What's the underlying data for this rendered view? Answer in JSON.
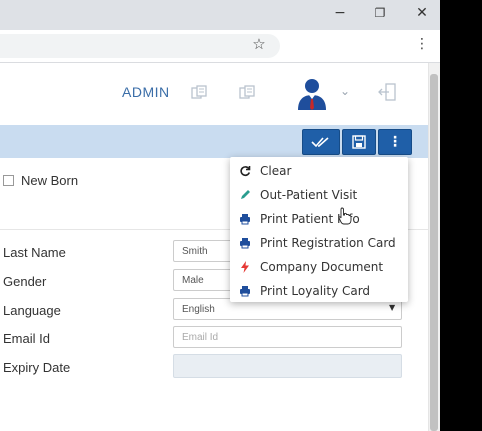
{
  "browser": {
    "window_controls": {
      "minimize": "−",
      "maximize": "❐",
      "close": "✕"
    },
    "bookmark_icon": "star-icon",
    "menu_icon": "vertical-dots-icon"
  },
  "header": {
    "user_label": "ADMIN",
    "user_dropdown_caret": "⌄"
  },
  "toolbar": {
    "buttons": [
      {
        "icon": "double-check-icon"
      },
      {
        "icon": "save-icon"
      },
      {
        "icon": "vertical-dots-icon"
      }
    ]
  },
  "form": {
    "new_born_label": "New Born",
    "rows": [
      {
        "label": "Last Name",
        "value": "Smith"
      },
      {
        "label": "Gender",
        "value": "Male"
      },
      {
        "label": "Language",
        "value": "English"
      },
      {
        "label": "Email Id",
        "placeholder": "Email Id"
      },
      {
        "label": "Expiry Date",
        "value": ""
      }
    ]
  },
  "menu": {
    "items": [
      {
        "label": "Clear",
        "icon": "refresh-icon",
        "color": "#222222"
      },
      {
        "label": "Out-Patient Visit",
        "icon": "pencil-icon",
        "color": "#2a9d8f"
      },
      {
        "label": "Print Patient Info",
        "icon": "printer-icon",
        "color": "#1f4e9c"
      },
      {
        "label": "Print Registration Card",
        "icon": "printer-icon",
        "color": "#1f4e9c"
      },
      {
        "label": "Company Document",
        "icon": "bolt-icon",
        "color": "#e53935"
      },
      {
        "label": "Print Loyality Card",
        "icon": "printer-icon",
        "color": "#1f4e9c"
      }
    ]
  },
  "colors": {
    "toolbar_bg": "#c9dcf0",
    "button_bg": "#1f5fa8",
    "accent_text": "#3b6ea8"
  }
}
